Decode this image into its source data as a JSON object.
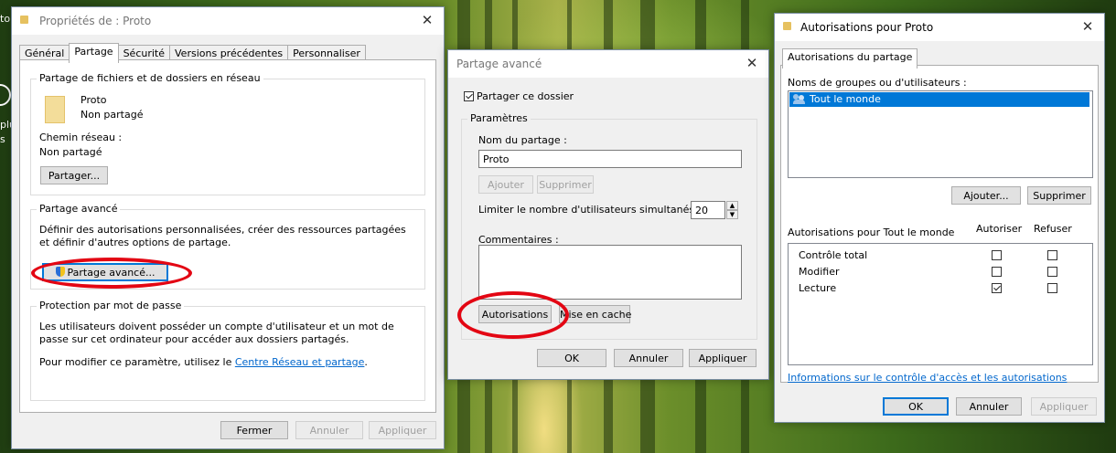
{
  "desktop": {
    "left_text_1": "to",
    "left_text_2": "plu",
    "left_text_3": "s"
  },
  "props": {
    "title": "Propriétés de : Proto",
    "tabs": [
      "Général",
      "Partage",
      "Sécurité",
      "Versions précédentes",
      "Personnaliser"
    ],
    "network_group_title": "Partage de fichiers et de dossiers en réseau",
    "folder_name": "Proto",
    "folder_status": "Non partagé",
    "network_path_label": "Chemin réseau :",
    "network_path_value": "Non partagé",
    "share_button": "Partager...",
    "advanced_group_title": "Partage avancé",
    "advanced_desc": "Définir des autorisations personnalisées, créer des ressources partagées et définir d'autres options de partage.",
    "advanced_button": "Partage avancé...",
    "password_group_title": "Protection par mot de passe",
    "password_desc": "Les utilisateurs doivent posséder un compte d'utilisateur et un mot de passe sur cet ordinateur pour accéder aux dossiers partagés.",
    "password_change_prefix": "Pour modifier ce paramètre, utilisez le ",
    "password_change_link": "Centre Réseau et partage",
    "password_change_suffix": ".",
    "btn_close": "Fermer",
    "btn_cancel": "Annuler",
    "btn_apply": "Appliquer"
  },
  "advanced": {
    "title": "Partage avancé",
    "share_checkbox_label": "Partager ce dossier",
    "share_checked": true,
    "settings_group_title": "Paramètres",
    "share_name_label": "Nom du partage :",
    "share_name_value": "Proto",
    "btn_add": "Ajouter",
    "btn_remove": "Supprimer",
    "limit_label": "Limiter le nombre d'utilisateurs simultanés à :",
    "limit_value": "20",
    "comments_label": "Commentaires :",
    "btn_permissions": "Autorisations",
    "btn_cache": "Mise en cache",
    "btn_ok": "OK",
    "btn_cancel": "Annuler",
    "btn_apply": "Appliquer"
  },
  "perms": {
    "title": "Autorisations pour Proto",
    "tab": "Autorisations du partage",
    "groups_label": "Noms de groupes ou d'utilisateurs :",
    "groups": [
      "Tout le monde"
    ],
    "btn_add": "Ajouter...",
    "btn_remove": "Supprimer",
    "perm_header": "Autorisations pour Tout le monde",
    "col_allow": "Autoriser",
    "col_deny": "Refuser",
    "rows": [
      {
        "name": "Contrôle total",
        "allow": false,
        "deny": false
      },
      {
        "name": "Modifier",
        "allow": false,
        "deny": false
      },
      {
        "name": "Lecture",
        "allow": true,
        "deny": false
      }
    ],
    "info_link": "Informations sur le contrôle d'accès et les autorisations",
    "btn_ok": "OK",
    "btn_cancel": "Annuler",
    "btn_apply": "Appliquer"
  }
}
